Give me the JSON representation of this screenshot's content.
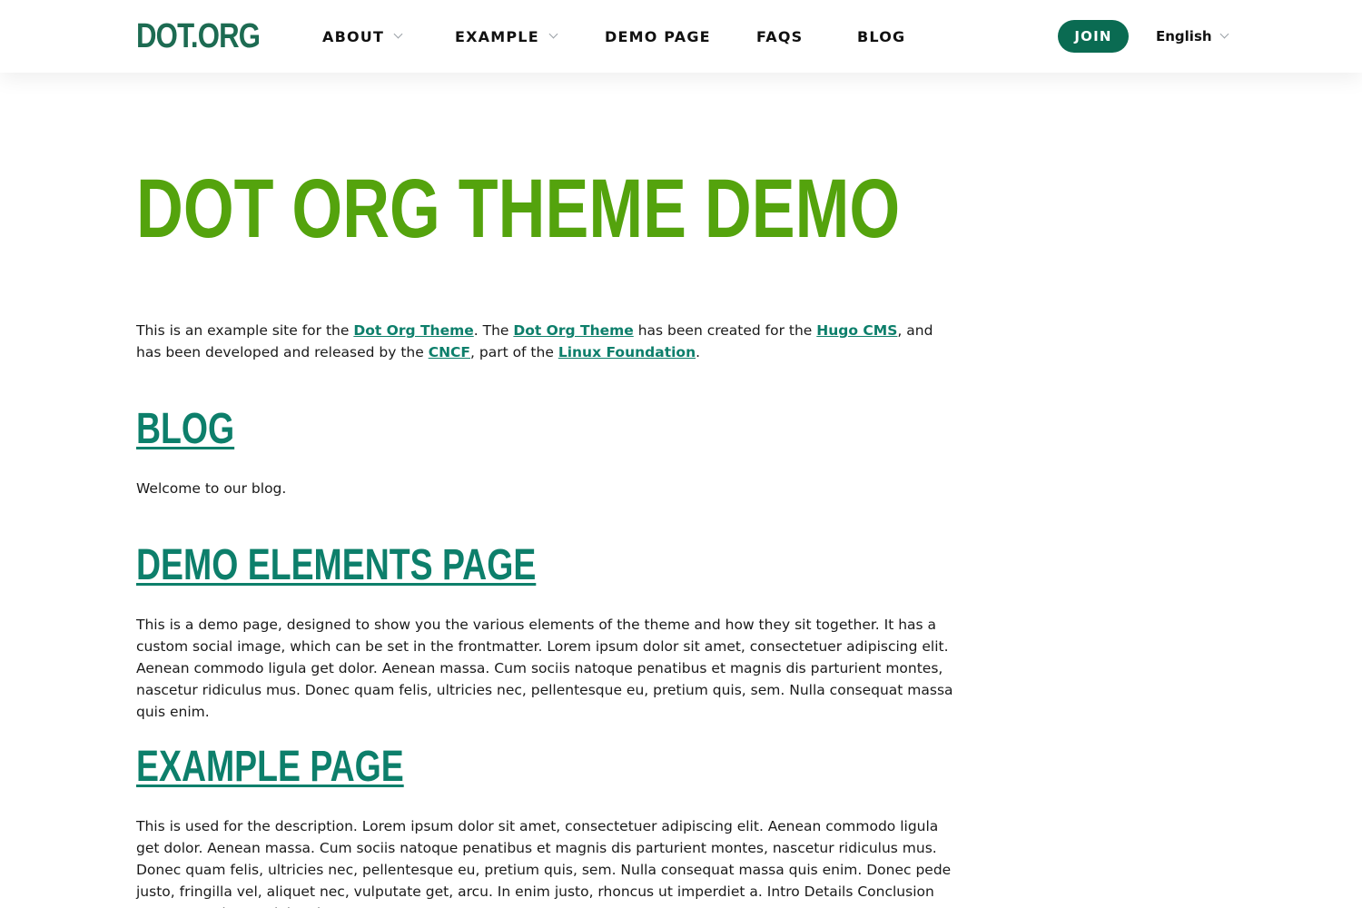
{
  "header": {
    "logo": "DOT.ORG",
    "nav": [
      {
        "label": "ABOUT",
        "has_dropdown": true
      },
      {
        "label": "EXAMPLE",
        "has_dropdown": true
      },
      {
        "label": "DEMO PAGE",
        "has_dropdown": false
      },
      {
        "label": "FAQS",
        "has_dropdown": false
      },
      {
        "label": "BLOG",
        "has_dropdown": false
      }
    ],
    "join_label": "JOIN",
    "language": "English"
  },
  "colors": {
    "brand_dark": "#1d6b52",
    "hero_green": "#54a30d",
    "link_teal": "#0d7f6b",
    "join_bg": "#0a6b52"
  },
  "hero": {
    "title": "DOT ORG THEME DEMO"
  },
  "intro": {
    "t1": "This is an example site for the ",
    "link1": "Dot Org Theme",
    "t2": ". The ",
    "link2": "Dot Org Theme",
    "t3": " has been created for the ",
    "link3": "Hugo CMS",
    "t4": ", and has been developed and released by the ",
    "link4": "CNCF",
    "t5": ", part of the ",
    "link5": "Linux Foundation",
    "t6": "."
  },
  "sections": [
    {
      "title": "BLOG",
      "text": "Welcome to our blog."
    },
    {
      "title": "DEMO ELEMENTS PAGE",
      "text": "This is a demo page, designed to show you the various elements of the theme and how they sit together. It has a custom social image, which can be set in the frontmatter. Lorem ipsum dolor sit amet, consectetuer adipiscing elit. Aenean commodo ligula get dolor. Aenean massa. Cum sociis natoque penatibus et magnis dis parturient montes, nascetur ridiculus mus. Donec quam felis, ultricies nec, pellentesque eu, pretium quis, sem. Nulla consequat massa quis enim."
    },
    {
      "title": "EXAMPLE PAGE",
      "text": "This is used for the description. Lorem ipsum dolor sit amet, consectetuer adipiscing elit. Aenean commodo ligula get dolor. Aenean massa. Cum sociis natoque penatibus et magnis dis parturient montes, nascetur ridiculus mus. Donec quam felis, ultricies nec, pellentesque eu, pretium quis, sem. Nulla consequat massa quis enim. Donec pede justo, fringilla vel, aliquet nec, vulputate get, arcu. In enim justo, rhoncus ut imperdiet a. Intro Details Conclusion Intro Lorem ipsum dolor sit amet,"
    }
  ]
}
